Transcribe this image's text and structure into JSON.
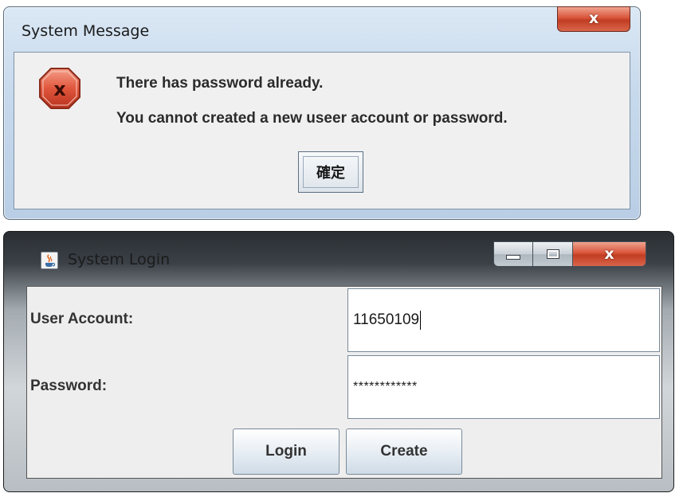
{
  "message_dialog": {
    "title": "System Message",
    "close_label": "x",
    "icon": "error-icon",
    "icon_color": "#d94b38",
    "line1": "There has password already.",
    "line2": "You cannot created a new useer account or password.",
    "ok_label": "確定"
  },
  "login_dialog": {
    "title": "System Login",
    "app_icon": "java-icon",
    "close_label": "x",
    "user_label": "User Account:",
    "user_value": "11650109",
    "password_label": "Password:",
    "password_value": "************",
    "login_label": "Login",
    "create_label": "Create"
  }
}
